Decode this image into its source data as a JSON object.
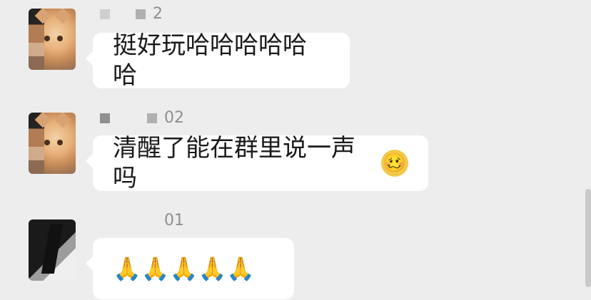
{
  "messages": [
    {
      "name_fragment": "2",
      "text": "挺好玩哈哈哈哈哈哈"
    },
    {
      "name_fragment": "02",
      "text": "清醒了能在群里说一声吗",
      "emoji": "🥴"
    },
    {
      "name_fragment": "01",
      "emoji": "🙏🙏🙏🙏🙏"
    }
  ]
}
